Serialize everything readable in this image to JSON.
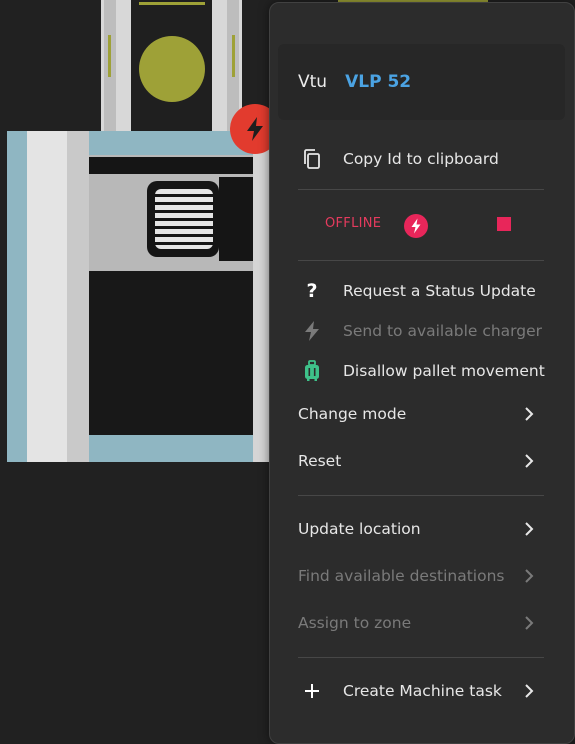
{
  "menu": {
    "header": {
      "label": "Vtu",
      "value": "VLP 52"
    },
    "copy_id": {
      "label": "Copy Id to clipboard",
      "icon": "copy-icon"
    },
    "status": {
      "text": "OFFLINE",
      "charge_icon": "bolt-icon",
      "stop_icon": "stop-icon",
      "accent": "#e8265a"
    },
    "actions": [
      {
        "label": "Request a Status Update",
        "icon": "question-icon",
        "disabled": false
      },
      {
        "label": "Send to available charger",
        "icon": "bolt-icon",
        "disabled": true
      },
      {
        "label": "Disallow pallet movement",
        "icon": "luggage-icon",
        "disabled": false
      }
    ],
    "submenus_a": [
      {
        "label": "Change mode"
      },
      {
        "label": "Reset"
      }
    ],
    "submenus_b": [
      {
        "label": "Update location",
        "disabled": false
      },
      {
        "label": "Find available destinations",
        "disabled": true
      },
      {
        "label": "Assign to zone",
        "disabled": true
      }
    ],
    "create_task": {
      "label": "Create Machine task",
      "icon": "plus-icon"
    }
  },
  "colors": {
    "menu_bg": "#2c2c2c",
    "link_blue": "#4ba3e3",
    "warning_red": "#e53b5e",
    "olive": "#9ea137",
    "pallet_green": "#3ec28a"
  }
}
